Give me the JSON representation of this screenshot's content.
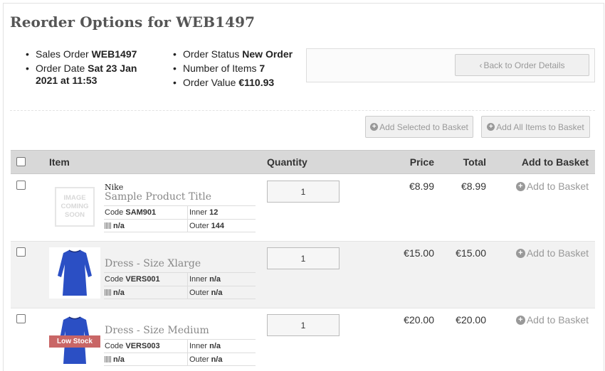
{
  "page": {
    "title": "Reorder Options for WEB1497"
  },
  "order": {
    "sales_order_label": "Sales Order",
    "sales_order_value": "WEB1497",
    "order_date_label": "Order Date",
    "order_date_value": "Sat 23 Jan 2021 at 11:53",
    "status_label": "Order Status",
    "status_value": "New Order",
    "items_label": "Number of Items",
    "items_value": "7",
    "value_label": "Order Value",
    "value_value": "€110.93"
  },
  "buttons": {
    "back": "Back to Order Details",
    "add_selected": "Add Selected to Basket",
    "add_all": "Add All Items to Basket"
  },
  "table": {
    "headers": {
      "item": "Item",
      "quantity": "Quantity",
      "price": "Price",
      "total": "Total",
      "add": "Add to Basket"
    },
    "rows": [
      {
        "brand": "Nike",
        "title": "Sample Product Title",
        "code_label": "Code",
        "code": "SAM901",
        "inner_label": "Inner",
        "inner": "12",
        "barcode": "n/a",
        "outer_label": "Outer",
        "outer": "144",
        "qty": "1",
        "price": "€8.99",
        "total": "€8.99",
        "add": "Add to Basket",
        "image_text": "IMAGE COMING SOON"
      },
      {
        "brand": "",
        "title": "Dress - Size Xlarge",
        "code_label": "Code",
        "code": "VERS001",
        "inner_label": "Inner",
        "inner": "n/a",
        "barcode": "n/a",
        "outer_label": "Outer",
        "outer": "n/a",
        "qty": "1",
        "price": "€15.00",
        "total": "€15.00",
        "add": "Add to Basket"
      },
      {
        "brand": "",
        "title": "Dress - Size Medium",
        "code_label": "Code",
        "code": "VERS003",
        "inner_label": "Inner",
        "inner": "n/a",
        "barcode": "n/a",
        "outer_label": "Outer",
        "outer": "n/a",
        "qty": "1",
        "price": "€20.00",
        "total": "€20.00",
        "add": "Add to Basket",
        "badge": "Low Stock"
      }
    ]
  },
  "icons": {
    "plus": "plus-circle-icon",
    "back": "chevron-left-icon",
    "barcode": "barcode-icon",
    "dress": "dress-image"
  },
  "colors": {
    "header_bg": "#d8d8d8",
    "dress": "#2b4fc4",
    "low_stock": "#c96666"
  }
}
